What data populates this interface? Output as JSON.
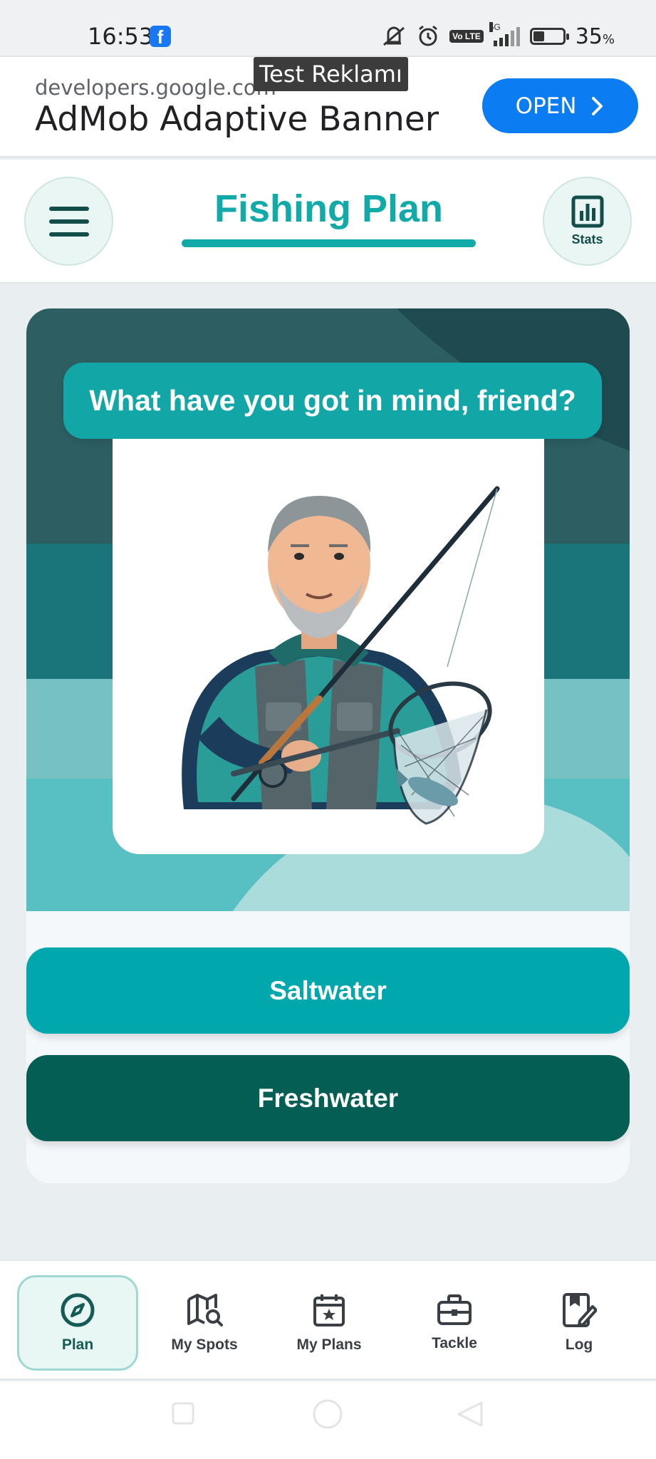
{
  "status_bar": {
    "time": "16:53",
    "notification_icon": "facebook-icon",
    "network": "5G",
    "volte": "Vo LTE",
    "battery_percent": "35",
    "battery_unit": "%",
    "battery_level": 0.35
  },
  "ad": {
    "domain": "developers.google.com",
    "title": "AdMob Adaptive Banner",
    "test_label": "Test Reklamı",
    "open_label": "OPEN"
  },
  "header": {
    "title": "Fishing Plan",
    "stats_label": "Stats"
  },
  "main": {
    "question": "What have you got in mind, friend?",
    "options": [
      {
        "label": "Saltwater"
      },
      {
        "label": "Freshwater"
      }
    ]
  },
  "bottom_nav": {
    "items": [
      {
        "label": "Plan",
        "icon": "compass-icon",
        "active": true
      },
      {
        "label": "My Spots",
        "icon": "map-search-icon",
        "active": false
      },
      {
        "label": "My Plans",
        "icon": "calendar-star-icon",
        "active": false
      },
      {
        "label": "Tackle",
        "icon": "toolbox-icon",
        "active": false
      },
      {
        "label": "Log",
        "icon": "log-edit-icon",
        "active": false
      }
    ]
  },
  "colors": {
    "accent": "#12a9a9",
    "saltwater": "#00a7ad",
    "freshwater": "#045e54",
    "ad_button": "#0b7cf2"
  }
}
